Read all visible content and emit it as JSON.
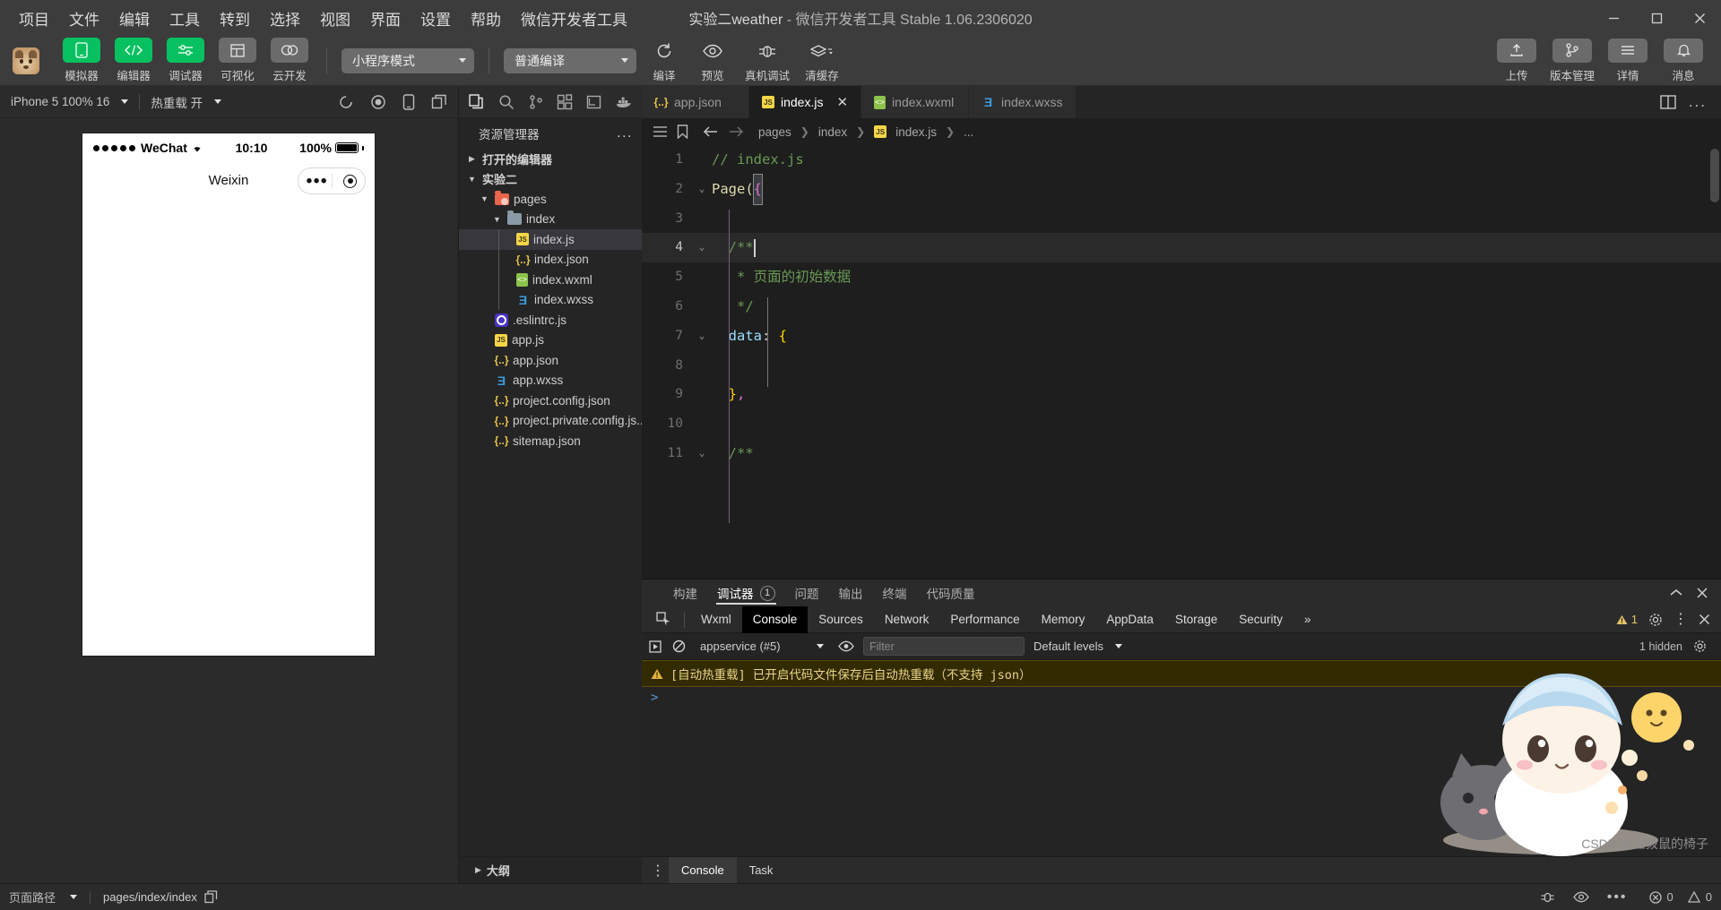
{
  "titlebar": {
    "menus": [
      "项目",
      "文件",
      "编辑",
      "工具",
      "转到",
      "选择",
      "视图",
      "界面",
      "设置",
      "帮助",
      "微信开发者工具"
    ],
    "project_name": "实验二weather",
    "title_suffix": " - 微信开发者工具 Stable 1.06.2306020",
    "window_minimize": "–",
    "window_maximize": "□",
    "window_close": "✕"
  },
  "toolbar": {
    "avatar_name": "project-avatar",
    "mode_buttons": [
      {
        "label": "模拟器",
        "icon": "phone-icon",
        "style": "green"
      },
      {
        "label": "编辑器",
        "icon": "code-icon",
        "style": "green"
      },
      {
        "label": "调试器",
        "icon": "sliders-icon",
        "style": "green"
      },
      {
        "label": "可视化",
        "icon": "layout-icon",
        "style": "grey"
      },
      {
        "label": "云开发",
        "icon": "cloud-icon",
        "style": "grey"
      }
    ],
    "mode_select": "小程序模式",
    "compile_select": "普通编译",
    "actions": [
      {
        "label": "编译",
        "icon": "refresh-icon"
      },
      {
        "label": "预览",
        "icon": "eye-icon"
      },
      {
        "label": "真机调试",
        "icon": "bug-icon"
      },
      {
        "label": "清缓存",
        "icon": "layers-icon",
        "caret": true
      }
    ],
    "right_buttons": [
      {
        "label": "上传",
        "icon": "upload-icon"
      },
      {
        "label": "版本管理",
        "icon": "branch-icon"
      },
      {
        "label": "详情",
        "icon": "menu-icon"
      },
      {
        "label": "消息",
        "icon": "bell-icon"
      }
    ]
  },
  "simulator": {
    "device": "iPhone 5 100% 16",
    "hotreload": "热重载 开",
    "toolbar_icons": [
      "rotate-icon",
      "record-icon",
      "device-icon",
      "copy-icon"
    ],
    "phone": {
      "carrier": "WeChat",
      "time": "10:10",
      "battery_pct": "100%",
      "page_title": "Weixin"
    }
  },
  "explorer": {
    "action_icons": [
      "files-icon",
      "search-icon",
      "source-control-icon",
      "extensions-icon",
      "debug-icon",
      "docker-icon"
    ],
    "title": "资源管理器",
    "more": "...",
    "sections": [
      {
        "label": "打开的编辑器",
        "expanded": false,
        "depth": 0
      },
      {
        "label": "实验二",
        "expanded": true,
        "depth": 0
      }
    ],
    "files": [
      {
        "label": "pages",
        "icon": "pages-folder-icon",
        "depth": 1,
        "expanded": true,
        "selected": false
      },
      {
        "label": "index",
        "icon": "folder-icon",
        "depth": 2,
        "expanded": true,
        "selected": false
      },
      {
        "label": "index.js",
        "icon": "js-icon",
        "depth": 3,
        "selected": true
      },
      {
        "label": "index.json",
        "icon": "json-icon",
        "depth": 3,
        "selected": false
      },
      {
        "label": "index.wxml",
        "icon": "wxml-icon",
        "depth": 3,
        "selected": false
      },
      {
        "label": "index.wxss",
        "icon": "wxss-icon",
        "depth": 3,
        "selected": false
      },
      {
        "label": ".eslintrc.js",
        "icon": "eslint-icon",
        "depth": 2,
        "selected": false
      },
      {
        "label": "app.js",
        "icon": "js-icon",
        "depth": 2,
        "selected": false
      },
      {
        "label": "app.json",
        "icon": "json-icon",
        "depth": 2,
        "selected": false
      },
      {
        "label": "app.wxss",
        "icon": "wxss-icon",
        "depth": 2,
        "selected": false
      },
      {
        "label": "project.config.json",
        "icon": "json-icon",
        "depth": 2,
        "selected": false
      },
      {
        "label": "project.private.config.js...",
        "icon": "json-icon",
        "depth": 2,
        "selected": false
      },
      {
        "label": "sitemap.json",
        "icon": "json-icon",
        "depth": 2,
        "selected": false
      }
    ],
    "outline": "大纲"
  },
  "editor": {
    "tabs": [
      {
        "label": "app.json",
        "icon": "json-icon",
        "active": false,
        "closable": false
      },
      {
        "label": "index.js",
        "icon": "js-icon",
        "active": true,
        "closable": true
      },
      {
        "label": "index.wxml",
        "icon": "wxml-icon",
        "active": false,
        "closable": false
      },
      {
        "label": "index.wxss",
        "icon": "wxss-icon",
        "active": false,
        "closable": false
      }
    ],
    "tab_more": "...",
    "split_icon": "split-editor-icon",
    "breadcrumb": [
      "pages",
      "index",
      "index.js",
      "..."
    ],
    "breadcrumb_file_icon": "js-icon",
    "nav_icons": [
      "outline-icon",
      "bookmark-icon",
      "back-arrow-icon",
      "forward-arrow-icon"
    ],
    "lines": [
      {
        "n": "1",
        "fold": "",
        "indent": 0,
        "hl": false,
        "tokens": [
          {
            "t": "// index.js",
            "c": "c-comment"
          }
        ]
      },
      {
        "n": "2",
        "fold": "v",
        "indent": 0,
        "hl": false,
        "tokens": [
          {
            "t": "Page(",
            "c": "c-fn"
          },
          {
            "t": "{",
            "c": "c-brace-box"
          }
        ]
      },
      {
        "n": "3",
        "fold": "",
        "indent": 1,
        "hl": false,
        "tokens": []
      },
      {
        "n": "4",
        "fold": "v",
        "indent": 1,
        "hl": true,
        "tokens": [
          {
            "t": "  /**",
            "c": "c-comment"
          }
        ]
      },
      {
        "n": "5",
        "fold": "",
        "indent": 1,
        "hl": false,
        "tokens": [
          {
            "t": "   * 页面的初始数据",
            "c": "c-comment"
          }
        ]
      },
      {
        "n": "6",
        "fold": "",
        "indent": 1,
        "hl": false,
        "tokens": [
          {
            "t": "   */",
            "c": "c-comment"
          }
        ]
      },
      {
        "n": "7",
        "fold": "v",
        "indent": 1,
        "hl": false,
        "tokens": [
          {
            "t": "  data",
            "c": "c-prop"
          },
          {
            "t": ": ",
            "c": "c-punc"
          },
          {
            "t": "{",
            "c": "c-brace2"
          }
        ]
      },
      {
        "n": "8",
        "fold": "",
        "indent": 1,
        "hl": false,
        "tokens": []
      },
      {
        "n": "9",
        "fold": "",
        "indent": 1,
        "hl": false,
        "tokens": [
          {
            "t": "  }",
            "c": "c-brace2"
          },
          {
            "t": ",",
            "c": "c-brace"
          }
        ]
      },
      {
        "n": "10",
        "fold": "",
        "indent": 1,
        "hl": false,
        "tokens": []
      },
      {
        "n": "11",
        "fold": "v",
        "indent": 1,
        "hl": false,
        "tokens": [
          {
            "t": "  /**",
            "c": "c-comment"
          }
        ]
      }
    ]
  },
  "debugger": {
    "panel_tabs": [
      {
        "label": "构建",
        "active": false,
        "badge": null
      },
      {
        "label": "调试器",
        "active": true,
        "badge": "1"
      },
      {
        "label": "问题",
        "active": false,
        "badge": null
      },
      {
        "label": "输出",
        "active": false,
        "badge": null
      },
      {
        "label": "终端",
        "active": false,
        "badge": null
      },
      {
        "label": "代码质量",
        "active": false,
        "badge": null
      }
    ],
    "panel_controls": [
      "collapse-icon",
      "close-icon"
    ],
    "devtools_tabs": [
      {
        "label": "Wxml",
        "active": false
      },
      {
        "label": "Console",
        "active": true
      },
      {
        "label": "Sources",
        "active": false
      },
      {
        "label": "Network",
        "active": false
      },
      {
        "label": "Performance",
        "active": false
      },
      {
        "label": "Memory",
        "active": false
      },
      {
        "label": "AppData",
        "active": false
      },
      {
        "label": "Storage",
        "active": false
      },
      {
        "label": "Security",
        "active": false
      }
    ],
    "devtools_overflow": "»",
    "warning_count": "1",
    "settings_icon": "gear-icon",
    "kebab_icon": "kebab-icon",
    "close_icon": "close-icon",
    "inspect_icon": "inspect-icon",
    "console_context": "appservice (#5)",
    "filter_placeholder": "Filter",
    "default_levels": "Default levels",
    "hidden_count": "1 hidden",
    "console_settings_icon": "gear-icon",
    "messages": [
      {
        "type": "warning",
        "icon": "warning-triangle-icon",
        "text": "[自动热重载] 已开启代码文件保存后自动热重载（不支持 json）"
      }
    ],
    "prompt": ">",
    "bottom_tabs": [
      {
        "label": "Console",
        "active": true
      },
      {
        "label": "Task",
        "active": false
      }
    ]
  },
  "status_bar": {
    "page_path_label": "页面路径",
    "page_path_value": "pages/index/index",
    "copy_icon": "copy-icon",
    "right_icons": [
      "bug-icon",
      "eye-icon",
      "more-icon"
    ],
    "errors": "0",
    "warnings": "0",
    "error_icon": "error-circle-icon",
    "warning_icon": "warning-triangle-icon"
  },
  "watermark": {
    "credit": "CSDN @土拨鼠的椅子"
  },
  "colors": {
    "accent_green": "#07c160",
    "titlebar": "#3c3c3c",
    "editor_bg": "#1e1e1e",
    "sidebar_bg": "#252526",
    "warning": "#e2c36a"
  }
}
